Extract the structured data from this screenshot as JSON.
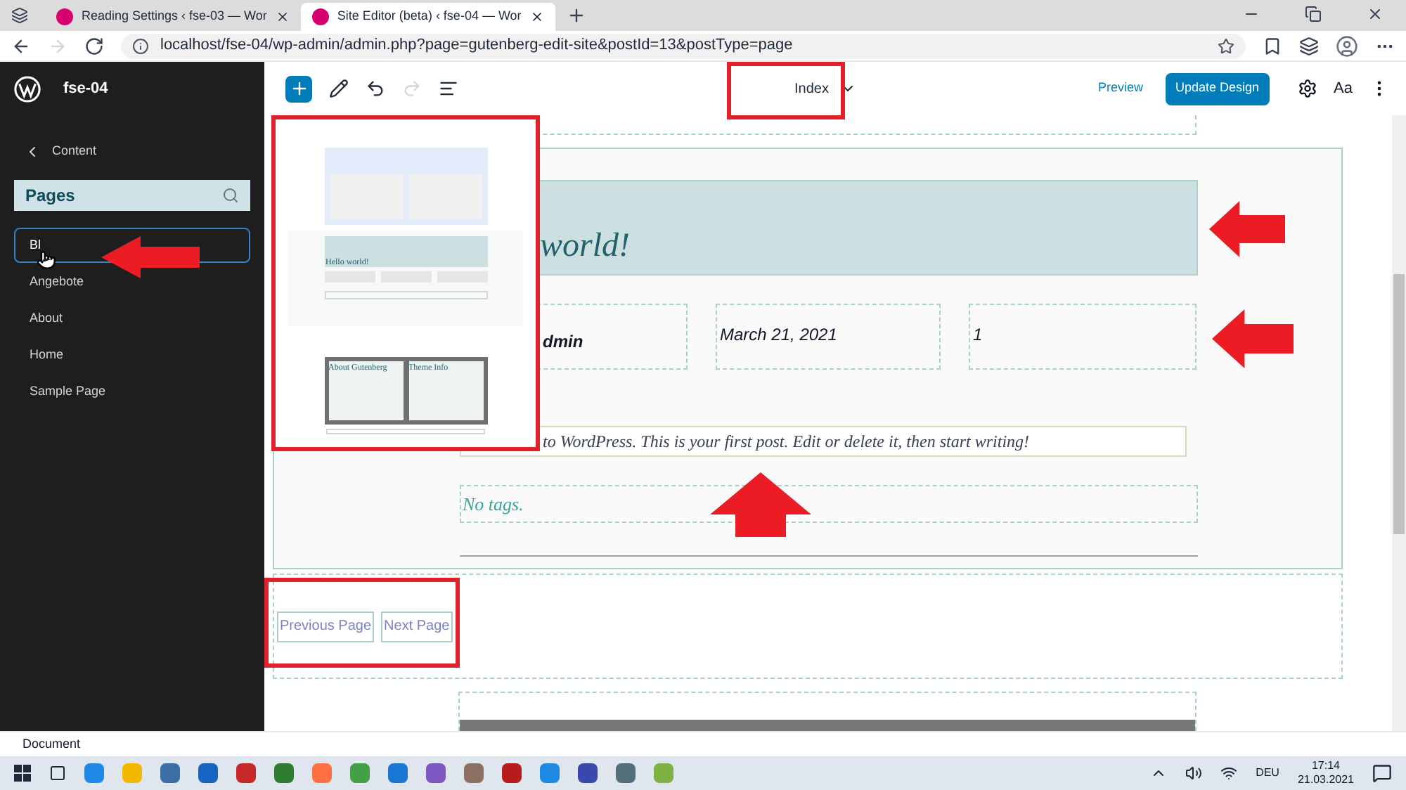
{
  "browser": {
    "tabs": [
      {
        "title": "Reading Settings ‹ fse-03 — Wor",
        "selected": false
      },
      {
        "title": "Site Editor (beta) ‹ fse-04 — Wor",
        "selected": true
      }
    ],
    "url": "localhost/fse-04/wp-admin/admin.php?page=gutenberg-edit-site&postId=13&postType=page"
  },
  "editor": {
    "site_title": "fse-04",
    "template": "Index",
    "preview": "Preview",
    "update": "Update Design",
    "styles": "Aa"
  },
  "sidebar": {
    "back": "Content",
    "search": "Pages",
    "items": [
      {
        "label": "Bl",
        "selected": true
      },
      {
        "label": "Angebote",
        "selected": false
      },
      {
        "label": "About",
        "selected": false
      },
      {
        "label": "Home",
        "selected": false
      },
      {
        "label": "Sample Page",
        "selected": false
      }
    ]
  },
  "preview": {
    "heading": "Hello world!",
    "columns": [
      "About Gutenberg",
      "Theme Info"
    ]
  },
  "canvas": {
    "heading": "world!",
    "author": "dmin",
    "date": "March 21, 2021",
    "comments": "1",
    "excerpt": "to WordPress. This is your first post. Edit or delete it, then start writing!",
    "tags": "No tags.",
    "pagination": [
      "Previous Page",
      "Next Page"
    ]
  },
  "status_bar": "Document",
  "taskbar": {
    "language": "DEU",
    "time": "17:14",
    "date": "21.03.2021"
  }
}
